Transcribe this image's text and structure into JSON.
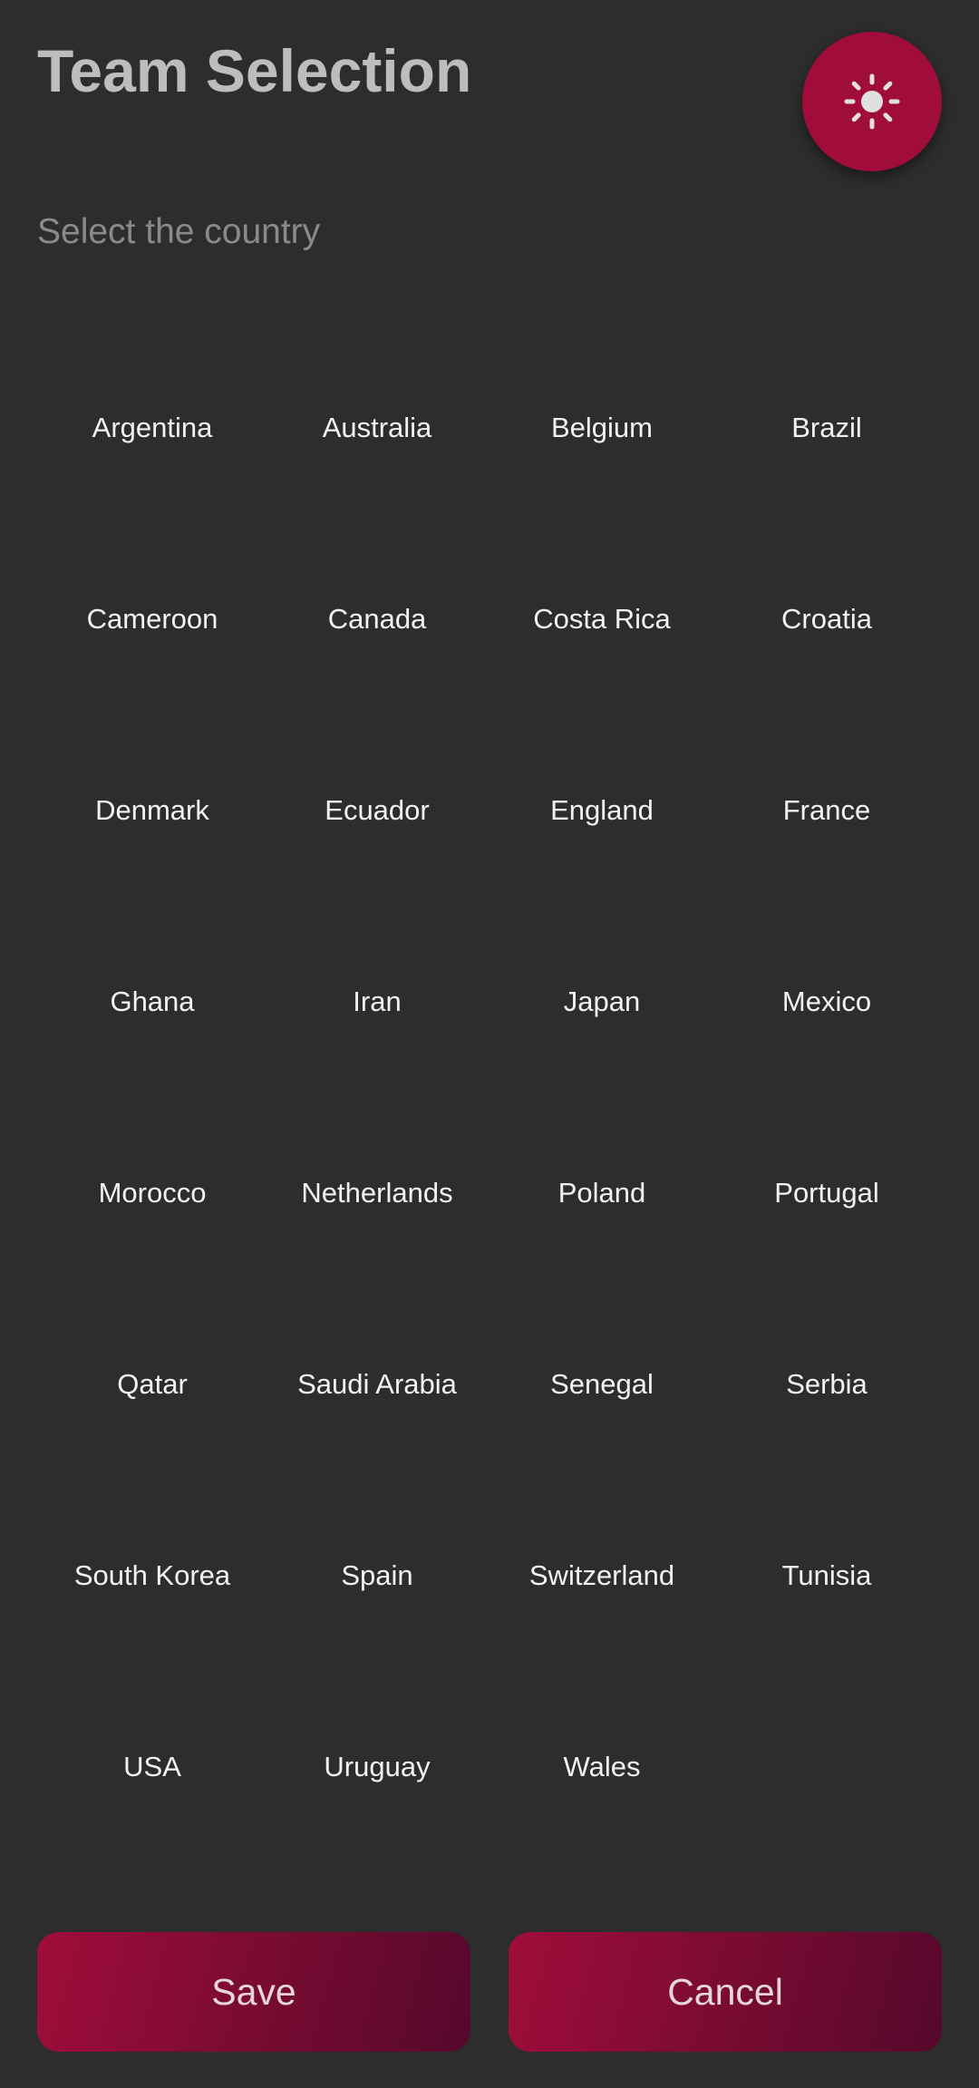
{
  "header": {
    "title": "Team Selection",
    "subtitle": "Select the country",
    "theme_toggle_icon": "sun-icon"
  },
  "countries": [
    "Argentina",
    "Australia",
    "Belgium",
    "Brazil",
    "Cameroon",
    "Canada",
    "Costa Rica",
    "Croatia",
    "Denmark",
    "Ecuador",
    "England",
    "France",
    "Ghana",
    "Iran",
    "Japan",
    "Mexico",
    "Morocco",
    "Netherlands",
    "Poland",
    "Portugal",
    "Qatar",
    "Saudi Arabia",
    "Senegal",
    "Serbia",
    "South Korea",
    "Spain",
    "Switzerland",
    "Tunisia",
    "USA",
    "Uruguay",
    "Wales"
  ],
  "actions": {
    "save_label": "Save",
    "cancel_label": "Cancel"
  },
  "colors": {
    "background": "#2d2d2d",
    "accent": "#a00d3a",
    "title": "#bdbdbd",
    "subtitle": "#8a8a8a",
    "country_text": "#f2f2f2"
  }
}
